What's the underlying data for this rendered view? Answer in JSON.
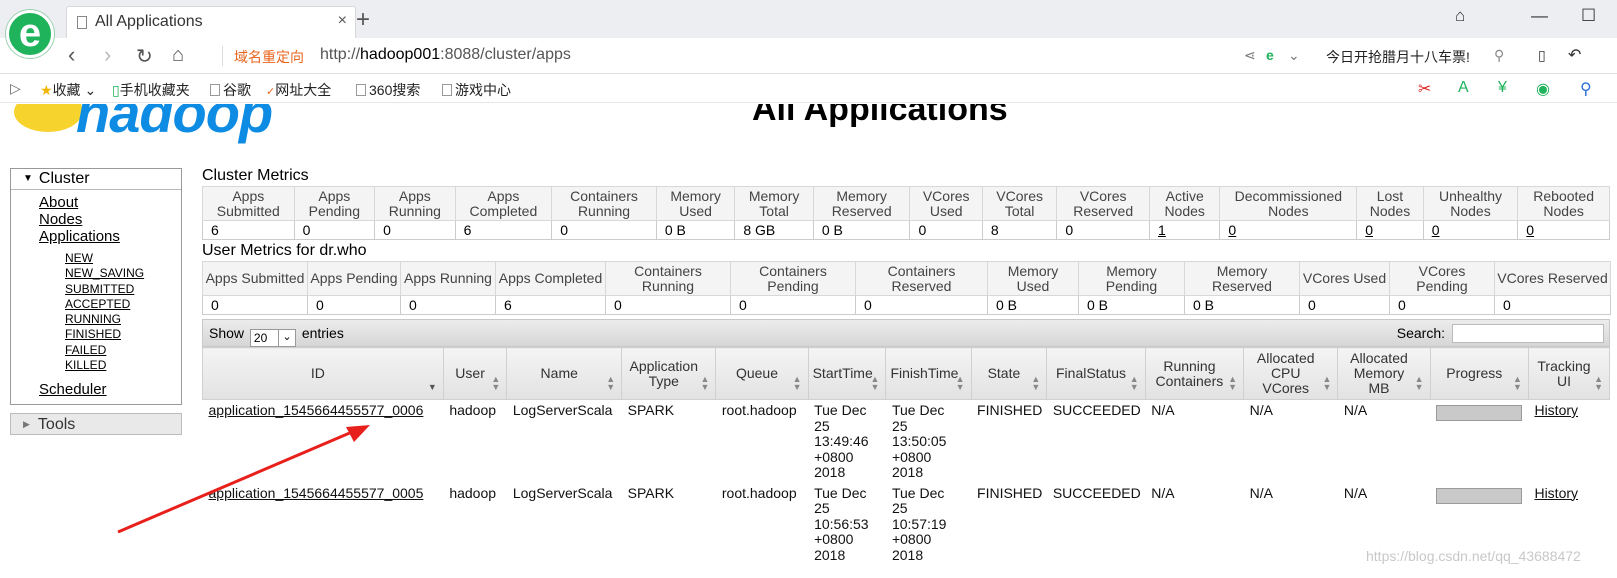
{
  "browser": {
    "tab_title": "All Applications",
    "tab_close": "×",
    "new_tab": "+",
    "redirect_label": "域名重定向",
    "url_prefix": "http://",
    "url_host": "hadoop001",
    "url_rest": ":8088/cluster/apps",
    "news_ticker": "今日开抢腊月十八车票!",
    "bookmarks": [
      "收藏",
      "手机收藏夹",
      "谷歌",
      "网址大全",
      "360搜索",
      "游戏中心"
    ]
  },
  "page": {
    "title": "All Applications",
    "logo_text": "hadoop"
  },
  "sidebar": {
    "cluster_label": "Cluster",
    "links": [
      "About",
      "Nodes",
      "Applications"
    ],
    "states": [
      "NEW",
      "NEW_SAVING",
      "SUBMITTED",
      "ACCEPTED",
      "RUNNING",
      "FINISHED",
      "FAILED",
      "KILLED"
    ],
    "scheduler": "Scheduler",
    "tools_label": "Tools"
  },
  "cluster_metrics": {
    "title": "Cluster Metrics",
    "headers": [
      "Apps Submitted",
      "Apps Pending",
      "Apps Running",
      "Apps Completed",
      "Containers Running",
      "Memory Used",
      "Memory Total",
      "Memory Reserved",
      "VCores Used",
      "VCores Total",
      "VCores Reserved",
      "Active Nodes",
      "Decommissioned Nodes",
      "Lost Nodes",
      "Unhealthy Nodes",
      "Rebooted Nodes"
    ],
    "values": [
      "6",
      "0",
      "0",
      "6",
      "0",
      "0 B",
      "8 GB",
      "0 B",
      "0",
      "8",
      "0",
      "1",
      "0",
      "0",
      "0",
      "0"
    ]
  },
  "user_metrics": {
    "title": "User Metrics for dr.who",
    "headers": [
      "Apps Submitted",
      "Apps Pending",
      "Apps Running",
      "Apps Completed",
      "Containers Running",
      "Containers Pending",
      "Containers Reserved",
      "Memory Used",
      "Memory Pending",
      "Memory Reserved",
      "VCores Used",
      "VCores Pending",
      "VCores Reserved"
    ],
    "values": [
      "0",
      "0",
      "0",
      "6",
      "0",
      "0",
      "0",
      "0 B",
      "0 B",
      "0 B",
      "0",
      "0",
      "0"
    ]
  },
  "apps_table": {
    "show_label": "Show",
    "entries_value": "20",
    "entries_label": "entries",
    "search_label": "Search:",
    "headers": [
      "ID",
      "User",
      "Name",
      "Application Type",
      "Queue",
      "StartTime",
      "FinishTime",
      "State",
      "FinalStatus",
      "Running Containers",
      "Allocated CPU VCores",
      "Allocated Memory MB",
      "Progress",
      "Tracking UI"
    ],
    "rows": [
      {
        "id": "application_1545664455577_0006",
        "user": "hadoop",
        "name": "LogServerScala",
        "type": "SPARK",
        "queue": "root.hadoop",
        "start": [
          "Tue Dec",
          "25",
          "13:49:46",
          "+0800",
          "2018"
        ],
        "finish": [
          "Tue Dec",
          "25",
          "13:50:05",
          "+0800",
          "2018"
        ],
        "state": "FINISHED",
        "final": "SUCCEEDED",
        "containers": "N/A",
        "vcores": "N/A",
        "memory": "N/A",
        "progress": 1.0,
        "tracking": "History"
      },
      {
        "id": "application_1545664455577_0005",
        "user": "hadoop",
        "name": "LogServerScala",
        "type": "SPARK",
        "queue": "root.hadoop",
        "start": [
          "Tue Dec",
          "25",
          "10:56:53",
          "+0800",
          "2018"
        ],
        "finish": [
          "Tue Dec",
          "25",
          "10:57:19",
          "+0800",
          "2018"
        ],
        "state": "FINISHED",
        "final": "SUCCEEDED",
        "containers": "N/A",
        "vcores": "N/A",
        "memory": "N/A",
        "progress": 1.0,
        "tracking": "History"
      }
    ]
  },
  "watermark": "https://blog.csdn.net/qq_43688472",
  "colors": {
    "arrow": "#e8201c",
    "logo_blue": "#0e8ce4",
    "redirect": "#e9661e"
  }
}
